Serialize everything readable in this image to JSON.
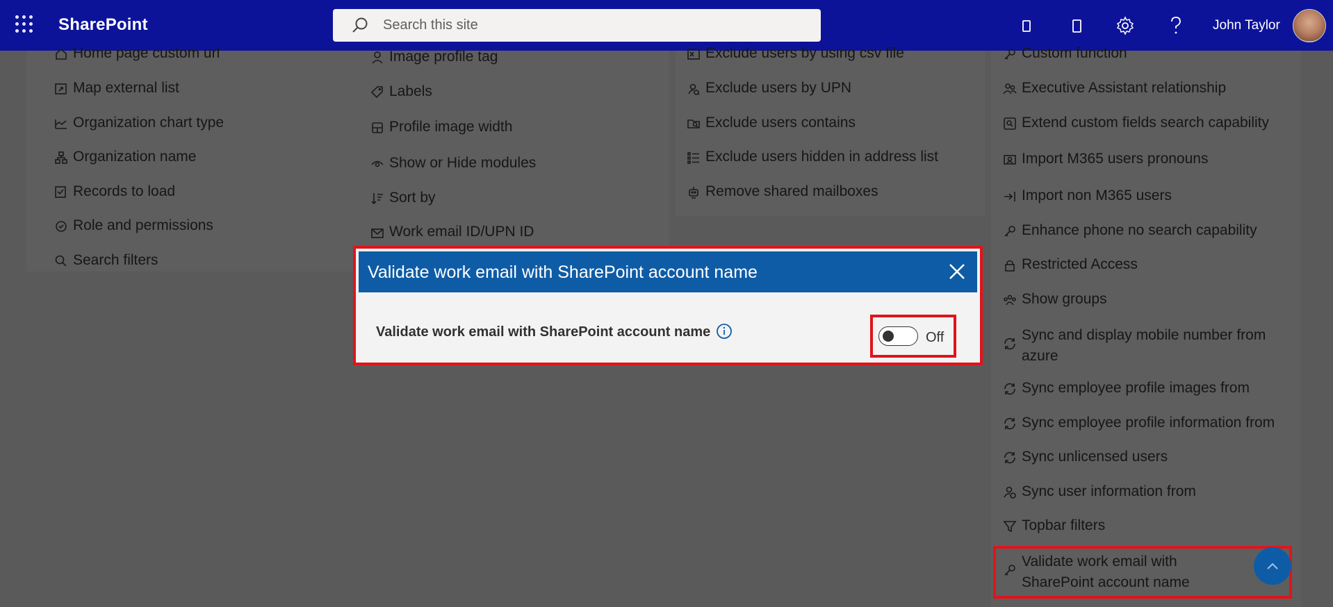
{
  "topbar": {
    "brand": "SharePoint",
    "search_placeholder": "Search this site",
    "username": "John Taylor",
    "icons": [
      "app-launcher-icon",
      "device-icon",
      "mobile-icon",
      "gear-icon",
      "help-icon"
    ]
  },
  "col1": {
    "items": [
      {
        "label": "Home page custom url",
        "icon": "home-icon"
      },
      {
        "label": "Map external list",
        "icon": "map-list-icon"
      },
      {
        "label": "Organization chart type",
        "icon": "chart-icon"
      },
      {
        "label": "Organization name",
        "icon": "org-icon"
      },
      {
        "label": "Records to load",
        "icon": "records-icon"
      },
      {
        "label": "Role and permissions",
        "icon": "badge-icon"
      },
      {
        "label": "Search filters",
        "icon": "search-icon"
      }
    ]
  },
  "col2": {
    "items": [
      {
        "label": "Image profile tag",
        "icon": "person-icon"
      },
      {
        "label": "Labels",
        "icon": "tag-icon"
      },
      {
        "label": "Profile image width",
        "icon": "layout-icon"
      },
      {
        "label": "Show or Hide modules",
        "icon": "eye-icon"
      },
      {
        "label": "Sort by",
        "icon": "sort-icon"
      },
      {
        "label": "Work email ID/UPN ID",
        "icon": "mail-icon"
      }
    ]
  },
  "col3": {
    "items": [
      {
        "label": "Exclude users by using csv file",
        "icon": "excel-icon"
      },
      {
        "label": "Exclude users by UPN",
        "icon": "person-search-icon"
      },
      {
        "label": "Exclude users contains",
        "icon": "folder-search-icon"
      },
      {
        "label": "Exclude users hidden in address list",
        "icon": "list-icon"
      },
      {
        "label": "Remove shared mailboxes",
        "icon": "bot-icon"
      }
    ]
  },
  "col4": {
    "items": [
      {
        "label": "Custom function",
        "icon": "key-icon"
      },
      {
        "label": "Executive Assistant relationship",
        "icon": "people-icon"
      },
      {
        "label": "Extend custom fields search capability",
        "icon": "search-box-icon"
      },
      {
        "label": "Import M365 users pronouns",
        "icon": "contact-icon"
      },
      {
        "label": "Import non M365 users",
        "icon": "import-icon"
      },
      {
        "label": "Enhance phone no search capability",
        "icon": "key-icon"
      },
      {
        "label": "Restricted Access",
        "icon": "lock-icon"
      },
      {
        "label": "Show groups",
        "icon": "group-icon"
      },
      {
        "label": "Sync and display mobile number from azure",
        "icon": "sync-icon"
      },
      {
        "label": "Sync employee profile images from",
        "icon": "sync-icon"
      },
      {
        "label": "Sync employee profile information from",
        "icon": "sync-icon"
      },
      {
        "label": "Sync unlicensed users",
        "icon": "sync-icon"
      },
      {
        "label": "Sync user information from",
        "icon": "person-sync-icon"
      },
      {
        "label": "Topbar filters",
        "icon": "filter-icon"
      },
      {
        "label": "Validate work email with SharePoint account name",
        "icon": "key-icon"
      }
    ]
  },
  "dialog": {
    "title": "Validate work email with SharePoint account name",
    "setting_label": "Validate work email with SharePoint account name",
    "toggle_state": "Off",
    "toggle_on": false
  },
  "colors": {
    "topbar": "#0d1399",
    "dialog_header": "#0f5ca6",
    "highlight": "#e0141b",
    "overlay": "#5a5a5a"
  }
}
